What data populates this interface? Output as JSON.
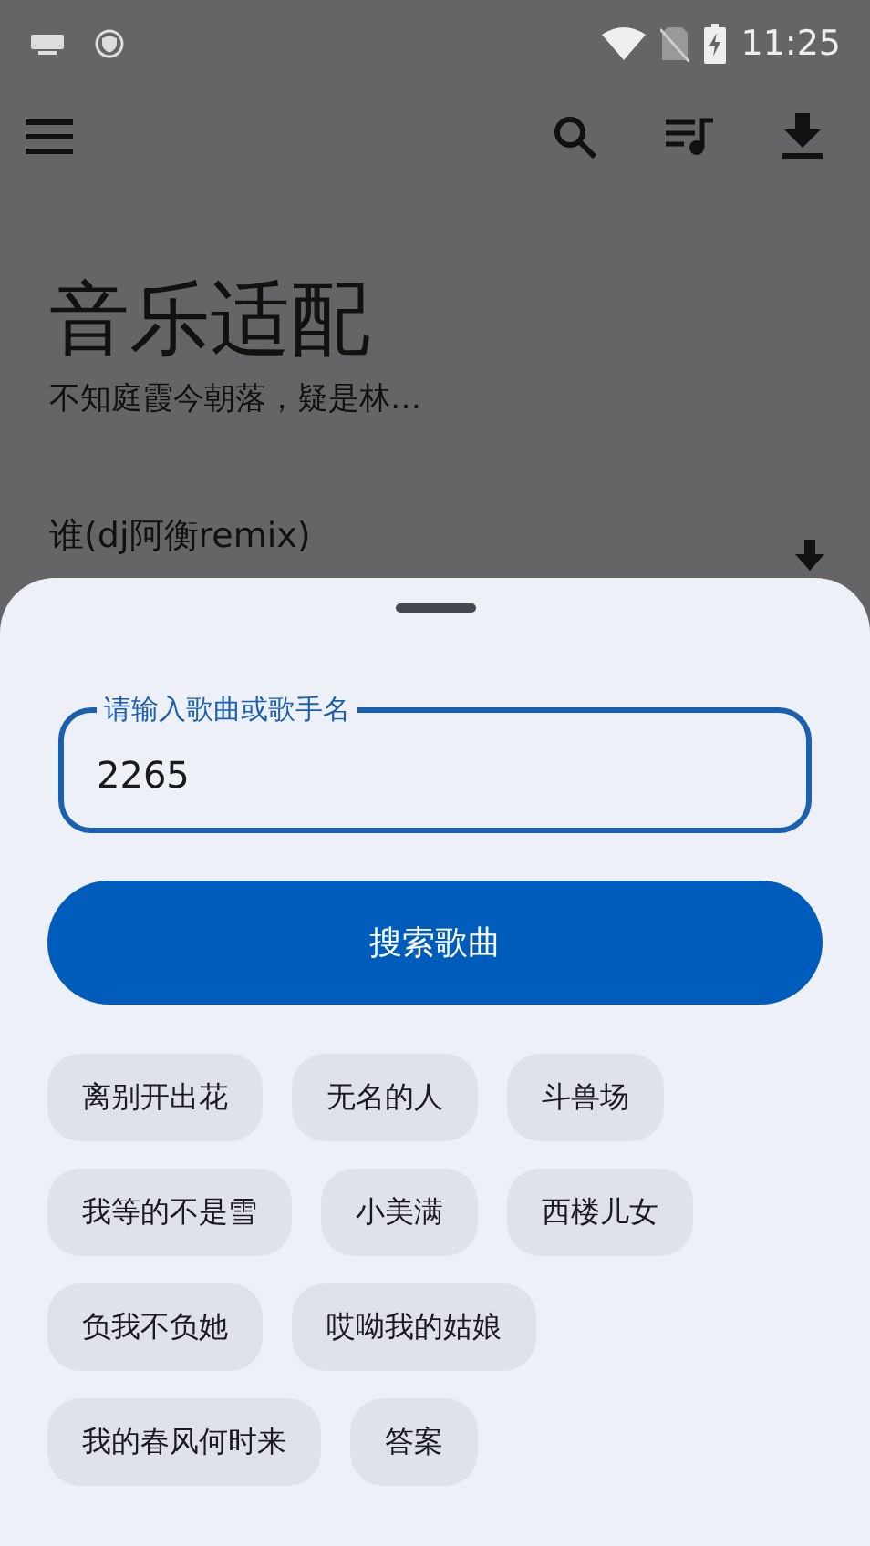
{
  "status_bar": {
    "time": "11:25"
  },
  "header": {
    "title": "音乐适配",
    "subtitle": "不知庭霞今朝落，疑是林…"
  },
  "song": {
    "title": "谁(dj阿衡remix)"
  },
  "sheet": {
    "search": {
      "label": "请输入歌曲或歌手名",
      "value": "2265"
    },
    "button": "搜索歌曲",
    "suggestions": [
      {
        "label": "离别开出花"
      },
      {
        "label": "无名的人"
      },
      {
        "label": "斗兽场"
      },
      {
        "label": "我等的不是雪"
      },
      {
        "label": "小美满"
      },
      {
        "label": "西楼儿女"
      },
      {
        "label": "负我不负她"
      },
      {
        "label": "哎呦我的姑娘"
      },
      {
        "label": "我的春风何时来"
      },
      {
        "label": "答案"
      }
    ]
  }
}
